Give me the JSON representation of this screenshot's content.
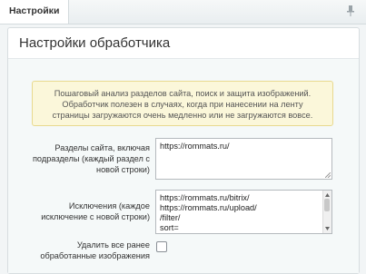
{
  "tabbar": {
    "active_tab": "Настройки"
  },
  "window": {
    "title": "Настройки обработчика"
  },
  "notice": {
    "text": "Пошаговый анализ разделов сайта, поиск и защита изображений. Обработчик полезен в случаях, когда при нанесении на ленту страницы загружаются очень медленно или не загружаются вовсе."
  },
  "fields": {
    "sections": {
      "label": "Разделы сайта, включая подразделы (каждый раздел с новой строки)",
      "lines": [
        "https://rommats.ru/"
      ]
    },
    "exclusions": {
      "label": "Исключения (каждое исключение с новой строки)",
      "lines": [
        "https://rommats.ru/bitrix/",
        "https://rommats.ru/upload/",
        "/filter/",
        "sort="
      ]
    },
    "delete_processed": {
      "label": "Удалить все ранее обработанные изображения",
      "checked": false
    }
  }
}
